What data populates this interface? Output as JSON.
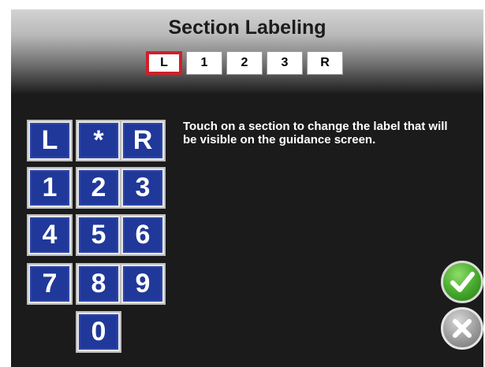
{
  "header": {
    "title": "Section Labeling"
  },
  "sections": [
    {
      "label": "L",
      "selected": true
    },
    {
      "label": "1",
      "selected": false
    },
    {
      "label": "2",
      "selected": false
    },
    {
      "label": "3",
      "selected": false
    },
    {
      "label": "R",
      "selected": false
    }
  ],
  "keypad": {
    "keys": [
      "L",
      "*",
      "R",
      "1",
      "2",
      "3",
      "4",
      "5",
      "6",
      "7",
      "8",
      "9",
      "0"
    ]
  },
  "instructions": "Touch on a section to change the label that will be visible on the guidance screen.",
  "buttons": {
    "confirm_icon": "checkmark-icon",
    "cancel_icon": "close-icon"
  },
  "colors": {
    "key_blue": "#203899",
    "selected_border": "#d0202a",
    "confirm_green": "#43a82a",
    "cancel_gray": "#9b9b9b"
  }
}
